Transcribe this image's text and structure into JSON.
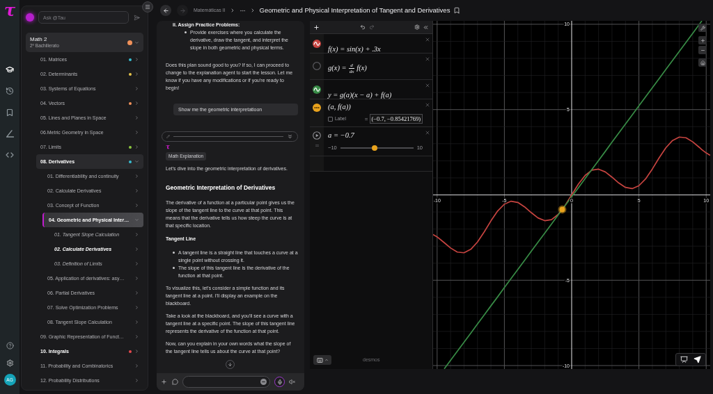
{
  "rail": {
    "logo": "τ",
    "nav": [
      {
        "selected": true
      },
      {
        "selected": false
      },
      {
        "selected": false
      },
      {
        "selected": false
      },
      {
        "selected": false
      }
    ],
    "user_initials": "AG"
  },
  "sidebar": {
    "search": {
      "placeholder": "Ask @Tau"
    },
    "course": {
      "title": "Math 2",
      "subtitle": "2º Bachillerato",
      "color": "#f0915a",
      "expanded": true
    },
    "items": [
      {
        "label": "01. Matrices",
        "color": "#38bdd0",
        "expanded": false,
        "selected": false,
        "emphasized": false
      },
      {
        "label": "02. Determinants",
        "color": "#e6c34a",
        "expanded": false,
        "selected": false,
        "emphasized": false
      },
      {
        "label": "03. Systems of Equations",
        "expanded": false,
        "selected": false,
        "emphasized": false
      },
      {
        "label": "04. Vectors",
        "color": "#f0915a",
        "expanded": false,
        "selected": false,
        "emphasized": false
      },
      {
        "label": "05. Lines and Planes in Space",
        "expanded": false,
        "selected": false,
        "emphasized": false
      },
      {
        "label": "06.Metric Geometry in Space",
        "expanded": false,
        "selected": false,
        "emphasized": false
      },
      {
        "label": "07. Limits",
        "color": "#8cc63f",
        "expanded": false,
        "selected": false,
        "emphasized": false
      },
      {
        "label": "08. Derivatives",
        "color": "#38bdd0",
        "expanded": true,
        "selected": false,
        "emphasized": true,
        "children": [
          {
            "label": "01. Differentiability and continuity",
            "expanded": false,
            "selected": false,
            "emphasized": false
          },
          {
            "label": "02. Calculate Derivatives",
            "expanded": false,
            "selected": false,
            "emphasized": false
          },
          {
            "label": "03. Concept of Function",
            "expanded": false,
            "selected": false,
            "emphasized": false
          },
          {
            "label": "04. Geometric and Physical Inter…",
            "expanded": true,
            "selected": true,
            "emphasized": true,
            "children": [
              {
                "label": "01. Tangent Slope Calculation",
                "expanded": false,
                "selected": false,
                "emphasized": false
              },
              {
                "label": "02. Calculate Derivatives",
                "expanded": false,
                "selected": false,
                "emphasized": true
              },
              {
                "label": "03. Definition of Limits",
                "expanded": false,
                "selected": false,
                "emphasized": false
              }
            ]
          },
          {
            "label": "05. Application of derivatives: asy…",
            "expanded": false,
            "selected": false,
            "emphasized": false
          },
          {
            "label": "06. Partial Derivatives",
            "expanded": false,
            "selected": false,
            "emphasized": false
          },
          {
            "label": "07. Solve Optimization Problems",
            "expanded": false,
            "selected": false,
            "emphasized": false
          },
          {
            "label": "08. Tangent Slope Calculation",
            "expanded": false,
            "selected": false,
            "emphasized": false
          }
        ]
      },
      {
        "label": "09. Graphic Representation of Funct…",
        "expanded": false,
        "selected": false,
        "emphasized": false
      },
      {
        "label": "10. Integrals",
        "color": "#e5484d",
        "expanded": false,
        "selected": false,
        "emphasized": true
      },
      {
        "label": "11. Probability and Combinatorics",
        "expanded": false,
        "selected": false,
        "emphasized": false
      },
      {
        "label": "12. Probability Distributions",
        "expanded": false,
        "selected": false,
        "emphasized": false
      }
    ]
  },
  "header": {
    "nav": [
      {
        "disabled": false
      },
      {
        "disabled": true
      }
    ],
    "breadcrumb": [
      "Matemáticas II"
    ],
    "title": "Geometric and Physical Interpretation of Tangent and Derivatives"
  },
  "chat": {
    "blocks": [
      {
        "kind": "list_item",
        "text": "ii. Assign Practice Problems:",
        "bullets": [
          "Provide exercises where you calculate the derivative, draw the tangent, and interpret the slope in both geometric and physical terms."
        ]
      },
      {
        "kind": "paragraph",
        "text": "Does this plan sound good to you? If so, I can proceed to change to the explanation agent to start the lesson. Let me know if you have any modifications or if you're ready to begin!"
      },
      {
        "kind": "user_message",
        "text": "Show me the geometric interpretatioon"
      },
      {
        "kind": "status"
      },
      {
        "kind": "agent",
        "logo": "τ",
        "tag": "Math Explanation"
      },
      {
        "kind": "paragraph",
        "text": "Let's dive into the geometric interpretation of derivatives."
      },
      {
        "kind": "heading",
        "text": "Geometric Interpretation of Derivatives"
      },
      {
        "kind": "paragraph",
        "text": "The derivative of a function at a particular point gives us the slope of the tangent line to the curve at that point. This means that the derivative tells us how steep the curve is at that specific location."
      },
      {
        "kind": "subheading",
        "text": "Tangent Line"
      },
      {
        "kind": "bullets",
        "items": [
          "A tangent line is a straight line that touches a curve at a single point without crossing it.",
          "The slope of this tangent line is the derivative of the function at that point."
        ]
      },
      {
        "kind": "paragraph",
        "text": "To visualize this, let's consider a simple function and its tangent line at a point. I'll display an example on the blackboard."
      },
      {
        "kind": "paragraph",
        "text": "Take a look at the blackboard, and you'll see a curve with a tangent line at a specific point. The slope of this tangent line represents the derivative of the function at that point."
      },
      {
        "kind": "paragraph",
        "text": "Now, can you explain in your own words what the slope of the tangent line tells us about the curve at that point?"
      }
    ]
  },
  "calculator": {
    "expressions": [
      {
        "kind": "function",
        "color": "#c74440",
        "hidden": false,
        "text": "f(x) = sin(x) + .3x"
      },
      {
        "kind": "derivative",
        "hidden": true,
        "lhs": "g(x) =",
        "numerator": "d",
        "denominator": "dx",
        "rhs": "f(x)"
      },
      {
        "kind": "function",
        "color": "#388c46",
        "hidden": false,
        "text": "y = g(a)(x − a) + f(a)"
      },
      {
        "kind": "point",
        "color": "#e9a31d",
        "text": "(a, f(a))",
        "label": {
          "text": "Label",
          "checked": false
        },
        "value_prefix": "=",
        "value": "(−0.7, −0.85421769)"
      },
      {
        "kind": "slider",
        "color": "#e9a31d",
        "text": "a = −0.7",
        "min": "−10",
        "max": "10",
        "level": 0.465
      }
    ],
    "branding": "desmos",
    "graph": {
      "chart_data": {
        "type": "line",
        "x": [
          -10.3,
          -10,
          -9.5,
          -9.47,
          -9,
          -8.5,
          -8,
          -7.5,
          -7,
          -6.5,
          -6,
          -5.5,
          -5,
          -4.5,
          -4,
          -3.5,
          -3,
          -2.5,
          -2,
          -1.5,
          -1,
          -0.7,
          -0.5,
          0,
          0.5,
          1,
          1.5,
          2,
          2.5,
          3,
          3.5,
          4,
          4.5,
          5,
          5.5,
          6,
          6.5,
          7,
          7.5,
          8,
          8.5,
          9,
          9.5,
          9.68,
          10,
          10.3
        ],
        "series": [
          {
            "color": "#c74440",
            "values": [
              -2.32,
              -2.46,
              -2.78,
              -2.8,
              -3.11,
              -3.35,
              -3.39,
              -3.19,
              -2.76,
              -2.17,
              -1.52,
              -0.94,
              -0.54,
              -0.37,
              -0.44,
              -0.7,
              -1.04,
              -1.35,
              -1.51,
              -1.45,
              -1.14,
              -0.85,
              -0.63,
              0,
              0.63,
              1.14,
              1.45,
              1.51,
              1.35,
              1.04,
              0.7,
              0.44,
              0.37,
              0.54,
              0.94,
              1.52,
              2.17,
              2.76,
              3.19,
              3.39,
              3.35,
              3.11,
              2.78,
              2.65,
              2.46,
              2.32
            ]
          },
          {
            "color": "#388c46",
            "values": [
              null,
              null,
              null,
              -10.19,
              -9.69,
              -9.16,
              -8.63,
              -8.1,
              -7.56,
              -7.03,
              -6.5,
              -5.97,
              -5.43,
              -4.9,
              -4.37,
              -3.84,
              -3.3,
              -2.77,
              -2.24,
              -1.71,
              -1.17,
              -0.85,
              -0.64,
              -0.11,
              0.42,
              0.96,
              1.49,
              2.02,
              2.55,
              3.09,
              3.62,
              4.15,
              4.68,
              5.22,
              5.75,
              6.28,
              6.81,
              7.35,
              7.88,
              8.41,
              8.94,
              9.47,
              10.01,
              10.2,
              null,
              null
            ]
          },
          {
            "color": "#e9a31d",
            "marker": true,
            "values": [
              null,
              null,
              null,
              null,
              null,
              null,
              null,
              null,
              null,
              null,
              null,
              null,
              null,
              null,
              null,
              null,
              null,
              null,
              null,
              null,
              null,
              -0.85,
              null,
              null,
              null,
              null,
              null,
              null,
              null,
              null,
              null,
              null,
              null,
              null,
              null,
              null,
              null,
              null,
              null,
              null,
              null,
              null,
              null,
              null,
              null,
              null
            ]
          }
        ],
        "xlim": [
          -10.3,
          10.3
        ],
        "ylim": [
          -10.2,
          10.2
        ],
        "xticks": [
          -10,
          -5,
          0,
          5,
          10
        ],
        "yticks": [
          -10,
          -5,
          5,
          10
        ],
        "grid": true
      }
    }
  }
}
